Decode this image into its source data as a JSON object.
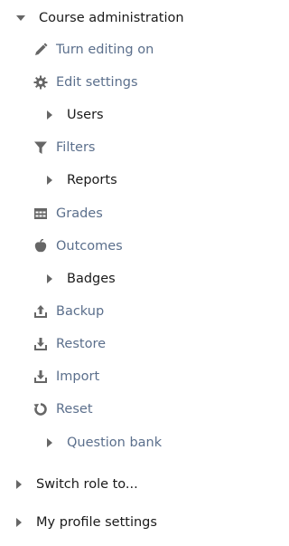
{
  "colors": {
    "link": "#5b6f8c",
    "text": "#1a1a1a",
    "icon": "#666666"
  },
  "nav": {
    "course_admin": {
      "label": "Course administration",
      "items": [
        {
          "label": "Turn editing on",
          "icon": "pencil-icon"
        },
        {
          "label": "Edit settings",
          "icon": "cog-icon"
        },
        {
          "label": "Users",
          "icon": "caret-right-icon"
        },
        {
          "label": "Filters",
          "icon": "filter-icon"
        },
        {
          "label": "Reports",
          "icon": "caret-right-icon"
        },
        {
          "label": "Grades",
          "icon": "table-icon"
        },
        {
          "label": "Outcomes",
          "icon": "outcomes-icon"
        },
        {
          "label": "Badges",
          "icon": "caret-right-icon"
        },
        {
          "label": "Backup",
          "icon": "upload-icon"
        },
        {
          "label": "Restore",
          "icon": "download-icon"
        },
        {
          "label": "Import",
          "icon": "download-icon"
        },
        {
          "label": "Reset",
          "icon": "reset-icon"
        },
        {
          "label": "Question bank",
          "icon": "caret-right-icon"
        }
      ]
    },
    "switch_role": {
      "label": "Switch role to..."
    },
    "profile_settings": {
      "label": "My profile settings"
    }
  }
}
